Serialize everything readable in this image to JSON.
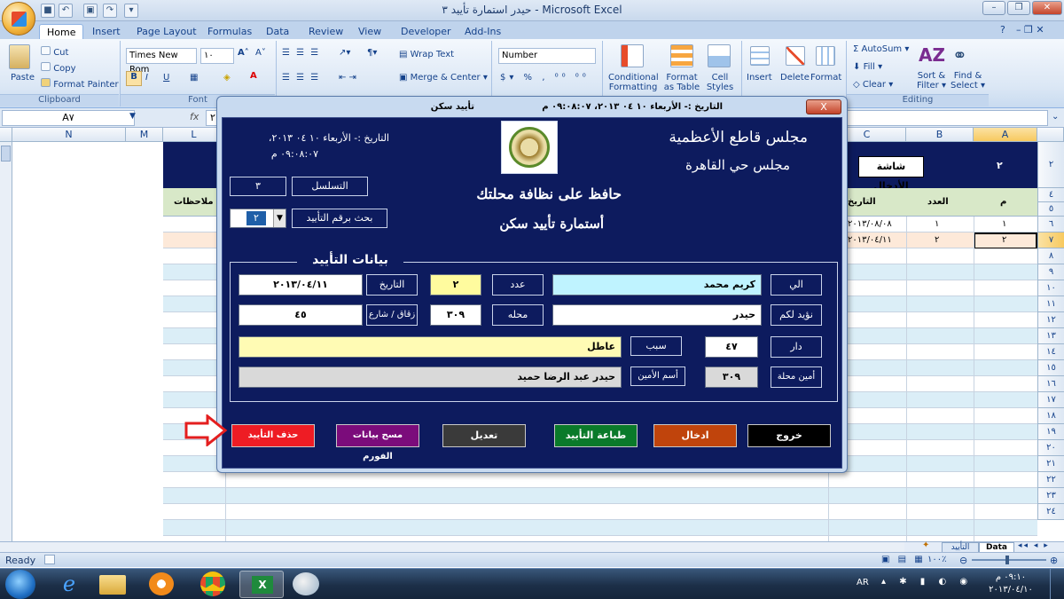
{
  "window": {
    "title": "حيدر استمارة تأييد ٣ - Microsoft Excel"
  },
  "ribbon": {
    "tabs": [
      "Home",
      "Insert",
      "Page Layout",
      "Formulas",
      "Data",
      "Review",
      "View",
      "Developer",
      "Add-Ins"
    ],
    "clipboard": {
      "paste": "Paste",
      "cut": "Cut",
      "copy": "Copy",
      "format_painter": "Format Painter",
      "group": "Clipboard"
    },
    "font": {
      "family": "Times New Rom",
      "size": "١٠",
      "group": "Font"
    },
    "alignment": {
      "wrap_text": "Wrap Text",
      "merge_center": "Merge & Center"
    },
    "number": {
      "format": "Number"
    },
    "styles": {
      "conditional": "Conditional",
      "conditional2": "Formatting",
      "format_as": "Format",
      "format_as2": "as Table",
      "cell": "Cell",
      "cell2": "Styles"
    },
    "cells": {
      "insert": "Insert",
      "delete": "Delete",
      "format": "Format"
    },
    "editing": {
      "autosum": "AutoSum",
      "fill": "Fill",
      "clear": "Clear",
      "sort": "Sort &",
      "sort2": "Filter",
      "find": "Find &",
      "find2": "Select",
      "group": "Editing"
    }
  },
  "formula_bar": {
    "name_box": "A٧",
    "fx": "fx",
    "value": "٢"
  },
  "sheet": {
    "column_headers": [
      "N",
      "M",
      "L",
      "C",
      "B",
      "A"
    ],
    "header_title": "٢",
    "header_button": "شاشة الأدخال",
    "table_headers": {
      "notes": "ملاحظات",
      "date": "التاريخ",
      "count": "العدد",
      "num": "م"
    },
    "rows": [
      {
        "date": "٢٠١٣/٠٨/٠٨",
        "count": "١",
        "num": "١"
      },
      {
        "date": "٢٠١٣/٠٤/١١",
        "count": "٢",
        "num": "٢"
      }
    ],
    "row_numbers": [
      "٢",
      "٤",
      "٥",
      "٦",
      "٧",
      "٨",
      "٩",
      "١٠",
      "١١",
      "١٢",
      "١٣",
      "١٤",
      "١٥",
      "١٦",
      "١٧",
      "١٨",
      "١٩",
      "٢٠",
      "٢١",
      "٢٢",
      "٢٣",
      "٢٤"
    ],
    "tabs": [
      "Data",
      "التأييد"
    ],
    "zoom": "١٠٠٪",
    "status": "Ready"
  },
  "dialog": {
    "title": "تأييد سكن",
    "title_date": "التاريخ :- الأربعاء  ١٠ ٠٤ ٢٠١٣، ٠٩:٠٨:٠٧ م",
    "close": "X",
    "date_line1": "التاريخ :- الأربعاء ١٠ ٠٤ ٢٠١٣،",
    "date_line2": "٠٩:٠٨:٠٧ م",
    "council1": "مجلس قاطع الأعظمية",
    "council2": "مجلس حي القاهرة",
    "slogan": "حافظ على نظافة محلتك",
    "form_title": "أستمارة تأييد سكن",
    "serial_label": "التسلسل",
    "serial_value": "٣",
    "search_label": "بحث برقم التأييد",
    "search_value": "٢",
    "section_title": "بيانات التأييد",
    "fields": {
      "to_label": "الي",
      "to_value": "كريم محمد",
      "count_label": "عدد",
      "count_value": "٢",
      "date_label": "التاريخ",
      "date_value": "٢٠١٣/٠٤/١١",
      "confirm_label": "نؤيد لكم",
      "confirm_value": "حيدر",
      "district_label": "محله",
      "district_value": "٣٠٩",
      "street_label": "زقاق / شارع",
      "street_value": "٤٥",
      "house_label": "دار",
      "house_value": "٤٧",
      "reason_label": "سبب",
      "reason_value": "عاطل",
      "mayor_district_label": "أمين محلة",
      "mayor_district_value": "٣٠٩",
      "mayor_name_label": "أسم الأمين",
      "mayor_name_value": "حيدر عبد الرضا حميد"
    },
    "buttons": {
      "exit": "خروج",
      "enter": "ادخال",
      "print": "طباعة التأييد",
      "edit": "تعديل",
      "clear": "مسح بيانات الفورم",
      "delete": "حذف التأييد"
    },
    "colors": {
      "panel": "#0d1b5e",
      "exit": "#000000",
      "enter": "#c0440c",
      "print": "#0a7a2a",
      "edit": "#3a3a3a",
      "clear": "#7b0c7b",
      "delete": "#ee1c24"
    }
  },
  "taskbar": {
    "lang": "AR",
    "time": "٠٩:١٠ م",
    "date": "٢٠١٣/٠٤/١٠"
  }
}
